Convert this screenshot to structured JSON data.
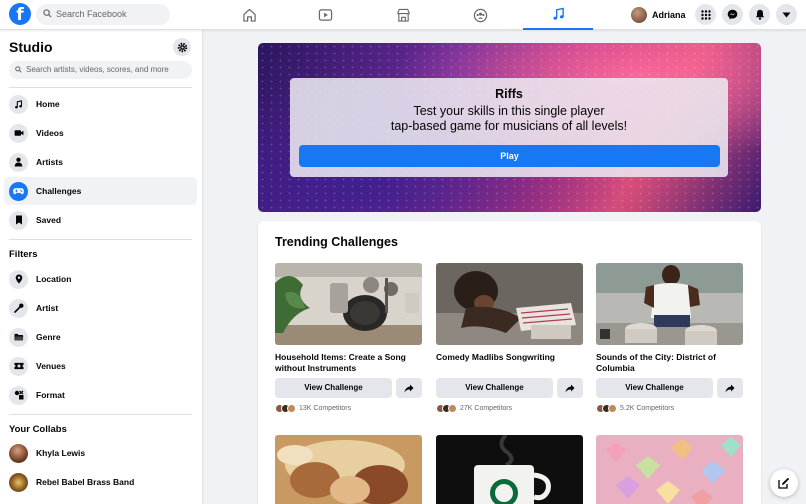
{
  "topbar": {
    "logo": "f",
    "search_placeholder": "Search Facebook",
    "nav_icons": [
      "home-icon",
      "watch-icon",
      "marketplace-icon",
      "groups-icon",
      "music-note-icon"
    ],
    "active_nav": "music-note-icon",
    "profile_name": "Adriana",
    "right_icons": [
      "grid-menu-icon",
      "messenger-icon",
      "bell-icon",
      "caret-down-icon"
    ]
  },
  "sidebar": {
    "title": "Studio",
    "search_placeholder": "Search artists, videos, scores, and more",
    "items": [
      {
        "label": "Home",
        "icon": "music-note-icon"
      },
      {
        "label": "Videos",
        "icon": "video-icon"
      },
      {
        "label": "Artists",
        "icon": "person-icon"
      },
      {
        "label": "Challenges",
        "icon": "gamepad-icon",
        "active": true
      },
      {
        "label": "Saved",
        "icon": "bookmark-icon"
      }
    ],
    "filters_heading": "Filters",
    "filters": [
      {
        "label": "Location",
        "icon": "pin-icon"
      },
      {
        "label": "Artist",
        "icon": "microphone-icon"
      },
      {
        "label": "Genre",
        "icon": "folder-icon"
      },
      {
        "label": "Venues",
        "icon": "ticket-icon"
      },
      {
        "label": "Format",
        "icon": "format-icon"
      }
    ],
    "collabs_heading": "Your Collabs",
    "collabs": [
      {
        "label": "Khyla Lewis"
      },
      {
        "label": "Rebel Babel Brass Band"
      }
    ]
  },
  "hero": {
    "title": "Riffs",
    "subtitle_line1": "Test your skills in this single player",
    "subtitle_line2": "tap-based game for musicians of all levels!",
    "play_label": "Play"
  },
  "trending": {
    "title": "Trending Challenges",
    "cards": [
      {
        "title": "Household Items: Create a Song without Instruments",
        "button": "View Challenge",
        "competitors": "13K Competitors"
      },
      {
        "title": "Comedy Madlibs Songwriting",
        "button": "View Challenge",
        "competitors": "27K Competitors"
      },
      {
        "title": "Sounds of the City: District of Columbia",
        "button": "View Challenge",
        "competitors": "5.2K Competitors"
      }
    ]
  },
  "colors": {
    "accent": "#1877f2",
    "background": "#f0f2f5"
  }
}
